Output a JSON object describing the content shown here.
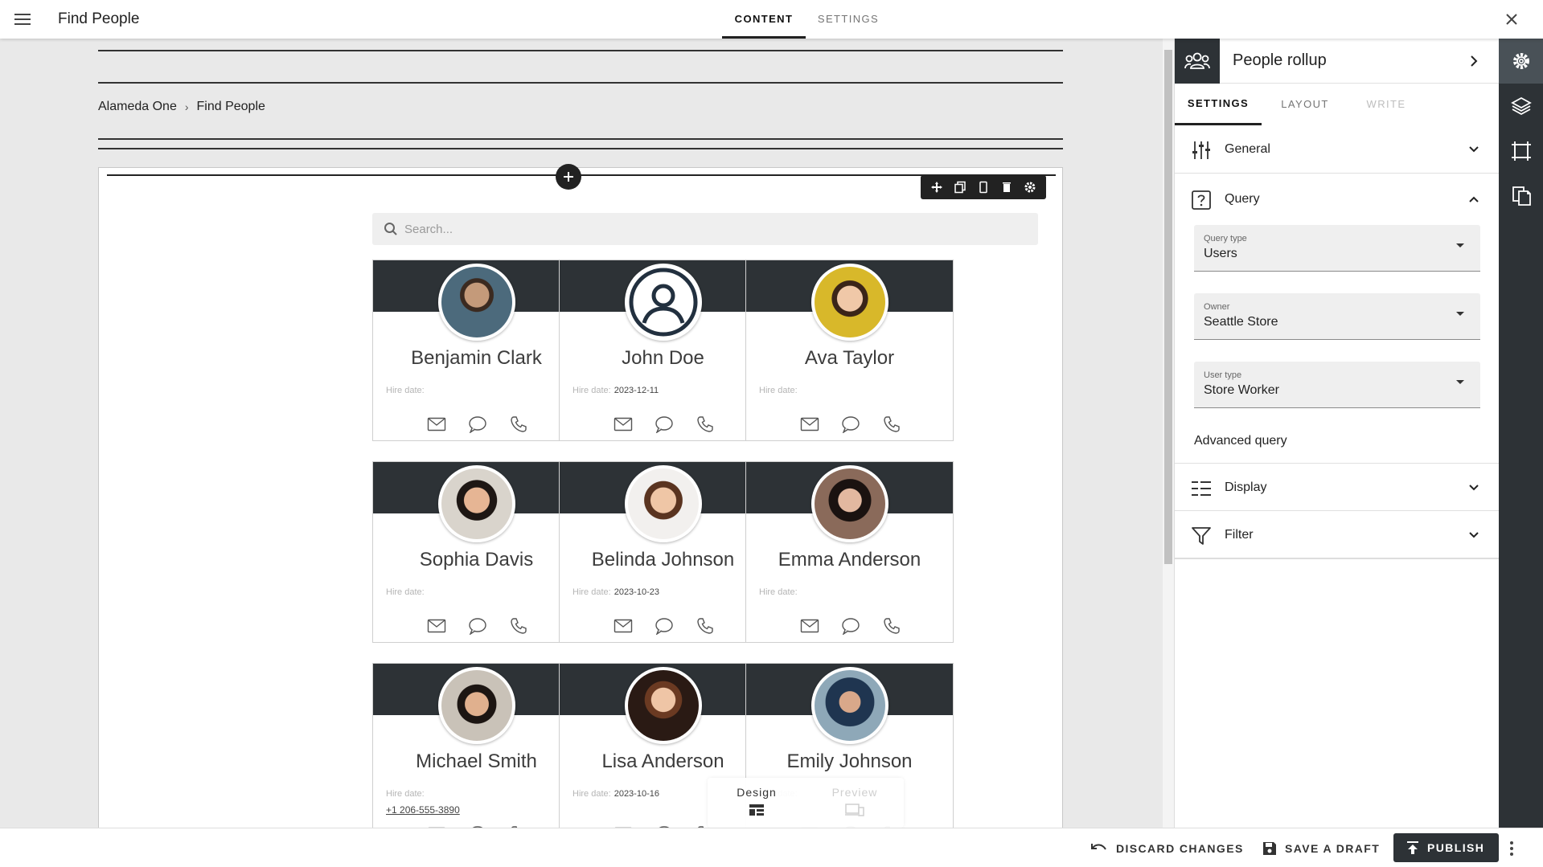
{
  "header": {
    "title": "Find People",
    "tabs": [
      {
        "label": "CONTENT",
        "active": true
      },
      {
        "label": "SETTINGS",
        "active": false
      }
    ]
  },
  "breadcrumb": {
    "items": [
      "Alameda One",
      "Find People"
    ],
    "separator": "›"
  },
  "search": {
    "placeholder": "Search..."
  },
  "hire_label": "Hire date:",
  "people": [
    {
      "name": "Benjamin Clark",
      "hire_date": "",
      "phone": "",
      "photo": "avatar-photo"
    },
    {
      "name": "John Doe",
      "hire_date": "2023-12-11",
      "phone": "",
      "photo": "default-user-icon"
    },
    {
      "name": "Ava Taylor",
      "hire_date": "",
      "phone": "",
      "photo": "avatar-photo"
    },
    {
      "name": "Sophia Davis",
      "hire_date": "",
      "phone": "",
      "photo": "avatar-photo"
    },
    {
      "name": "Belinda Johnson",
      "hire_date": "2023-10-23",
      "phone": "",
      "photo": "avatar-photo"
    },
    {
      "name": "Emma Anderson",
      "hire_date": "",
      "phone": "",
      "photo": "avatar-photo"
    },
    {
      "name": "Michael Smith",
      "hire_date": "",
      "phone": "+1 206-555-3890",
      "photo": "avatar-photo"
    },
    {
      "name": "Lisa Anderson",
      "hire_date": "2023-10-16",
      "phone": "",
      "photo": "avatar-photo"
    },
    {
      "name": "Emily Johnson",
      "hire_date": "",
      "phone": "",
      "photo": "avatar-photo"
    }
  ],
  "mode_switch": {
    "design": "Design",
    "preview": "Preview",
    "active": "design"
  },
  "panel": {
    "title": "People rollup",
    "tabs": [
      {
        "label": "SETTINGS",
        "active": true
      },
      {
        "label": "LAYOUT",
        "active": false
      },
      {
        "label": "WRITE",
        "active": false,
        "disabled": true
      }
    ],
    "sections": {
      "general": {
        "label": "General",
        "expanded": false
      },
      "query": {
        "label": "Query",
        "expanded": true
      },
      "display": {
        "label": "Display",
        "expanded": false
      },
      "filter": {
        "label": "Filter",
        "expanded": false
      }
    },
    "query": {
      "query_type": {
        "label": "Query type",
        "value": "Users"
      },
      "owner": {
        "label": "Owner",
        "value": "Seattle Store"
      },
      "user_type": {
        "label": "User type",
        "value": "Store Worker"
      },
      "advanced": "Advanced query"
    }
  },
  "rail": {
    "items": [
      "gear-icon",
      "layers-icon",
      "frame-icon",
      "pages-icon"
    ]
  },
  "footer": {
    "discard": "DISCARD CHANGES",
    "save_draft": "SAVE A DRAFT",
    "publish": "PUBLISH"
  },
  "colors": {
    "header_dark": "#2d3236",
    "canvas_bg": "#e9e9e9",
    "panel_bg": "#ffffff"
  }
}
